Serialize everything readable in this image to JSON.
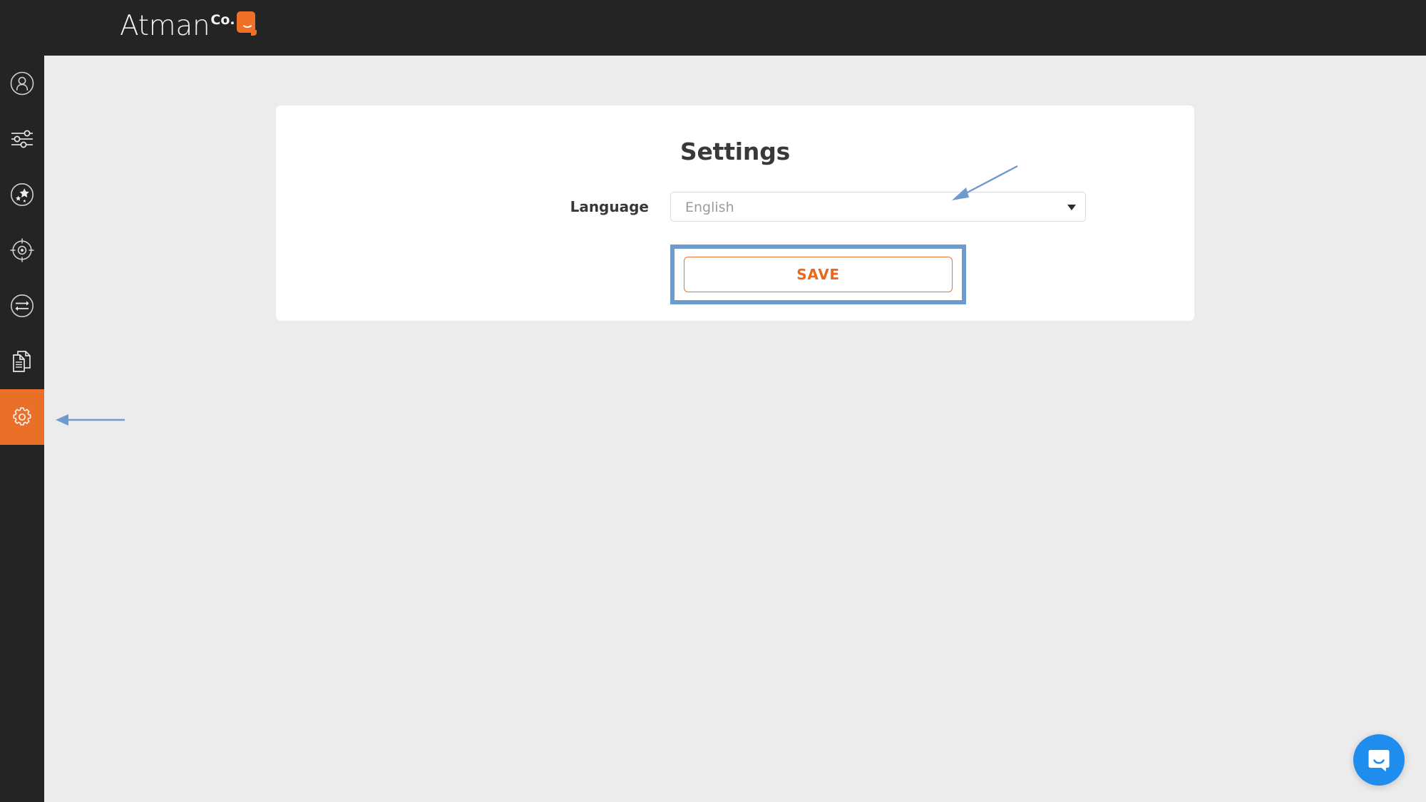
{
  "header": {
    "logo_word": "Atman",
    "logo_superscript": "Co.",
    "logo_badge_icon": "smile-badge-icon"
  },
  "sidebar": {
    "items": [
      {
        "id": "profile",
        "icon": "user-circle-icon",
        "label": "Profile",
        "active": false
      },
      {
        "id": "filters",
        "icon": "sliders-icon",
        "label": "Filters",
        "active": false
      },
      {
        "id": "talents",
        "icon": "stars-circle-icon",
        "label": "Talents",
        "active": false
      },
      {
        "id": "targets",
        "icon": "target-circle-icon",
        "label": "Targets",
        "active": false
      },
      {
        "id": "compare",
        "icon": "exchange-circle-icon",
        "label": "Compare",
        "active": false
      },
      {
        "id": "reports",
        "icon": "documents-icon",
        "label": "Reports",
        "active": false
      },
      {
        "id": "settings",
        "icon": "gear-icon",
        "label": "Settings",
        "active": true
      }
    ]
  },
  "main": {
    "card": {
      "title": "Settings",
      "language_field": {
        "label": "Language",
        "value": "English",
        "placeholder": "English",
        "caret_icon": "chevron-down-icon"
      },
      "save_label": "SAVE"
    }
  },
  "annotations": {
    "sidebar_arrow": "arrow-pointing-to-settings-nav",
    "select_arrow": "arrow-pointing-to-language-dropdown",
    "save_highlight": "highlight-box-around-save-button"
  },
  "widgets": {
    "intercom_launcher": "chat-bubble-icon"
  },
  "colors": {
    "accent_orange": "#ea6f28",
    "button_orange": "#ec6719",
    "sidebar_dark": "#242424",
    "page_background": "#ececec",
    "annotation_blue": "#6e9bcd",
    "intercom_blue": "#1f8ded"
  }
}
